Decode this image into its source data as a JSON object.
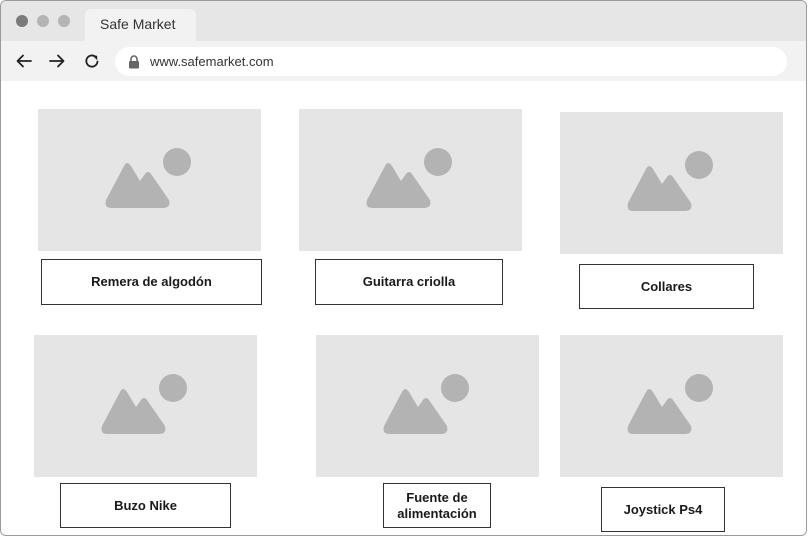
{
  "browser": {
    "tab_title": "Safe Market",
    "url": "www.safemarket.com"
  },
  "products": [
    {
      "label": "Remera de algodón"
    },
    {
      "label": "Guitarra criolla"
    },
    {
      "label": "Collares"
    },
    {
      "label": "Buzo Nike"
    },
    {
      "label": "Fuente de alimentación"
    },
    {
      "label": "Joystick Ps4"
    }
  ],
  "colors": {
    "chrome": "#e6e6e6",
    "toolbar": "#f2f2f2",
    "placeholder_bg": "#e5e5e5",
    "placeholder_icon": "#b3b3b3"
  },
  "icons": [
    "back-arrow-icon",
    "forward-arrow-icon",
    "reload-icon",
    "lock-icon",
    "image-placeholder-icon"
  ]
}
